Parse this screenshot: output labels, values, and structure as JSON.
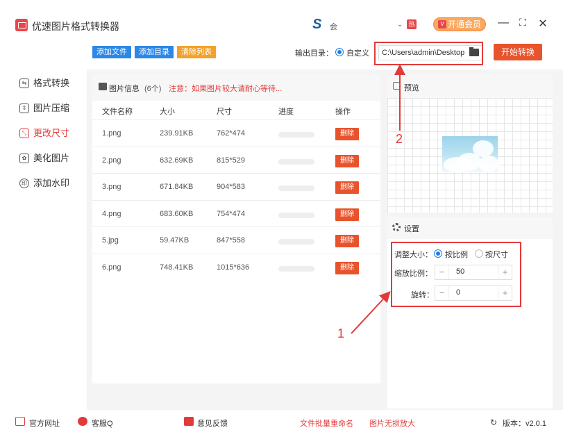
{
  "app": {
    "title": "优速图片格式转换器",
    "user_initial": "S",
    "user_name": "会",
    "hot_badge": "热",
    "vip_label": "开通会员",
    "vip_badge": "V"
  },
  "window": {
    "minimize": "—",
    "maximize": "⛶",
    "close": "✕",
    "dropdown": "⌄"
  },
  "toolbar": {
    "add_file": "添加文件",
    "add_dir": "添加目录",
    "clear_list": "清除列表",
    "output_label": "输出目录：",
    "output_option": "自定义",
    "output_path": "C:\\Users\\admin\\Desktop",
    "start": "开始转换",
    "colors": {
      "add": "#2c87e8",
      "clear": "#f2a12a",
      "start": "#e9532c"
    }
  },
  "sidebar": {
    "items": [
      {
        "label": "格式转换",
        "icon": "convert-icon",
        "glyph": "⇆",
        "active": false
      },
      {
        "label": "图片压缩",
        "icon": "compress-icon",
        "glyph": "⇕",
        "active": false
      },
      {
        "label": "更改尺寸",
        "icon": "resize-icon",
        "glyph": "⤡",
        "active": true
      },
      {
        "label": "美化图片",
        "icon": "beautify-icon",
        "glyph": "✿",
        "active": false
      },
      {
        "label": "添加水印",
        "icon": "watermark-icon",
        "glyph": "印",
        "active": false
      }
    ]
  },
  "file_list": {
    "title": "图片信息",
    "count": "(6个)",
    "warning": "注意：如果图片较大请耐心等待...",
    "columns": [
      "文件名称",
      "大小",
      "尺寸",
      "进度",
      "操作"
    ],
    "delete_label": "删除",
    "rows": [
      {
        "name": "1.png",
        "size": "239.91KB",
        "dims": "762*474"
      },
      {
        "name": "2.png",
        "size": "632.69KB",
        "dims": "815*529"
      },
      {
        "name": "3.png",
        "size": "671.84KB",
        "dims": "904*583"
      },
      {
        "name": "4.png",
        "size": "683.60KB",
        "dims": "754*474"
      },
      {
        "name": "5.jpg",
        "size": "59.47KB",
        "dims": "847*558"
      },
      {
        "name": "6.png",
        "size": "748.41KB",
        "dims": "1015*636"
      }
    ]
  },
  "preview": {
    "label": "预览"
  },
  "settings": {
    "label": "设置",
    "resize_label": "调整大小：",
    "option_ratio": "按比例",
    "option_size": "按尺寸",
    "scale_label": "缩放比例：",
    "scale_value": "50",
    "rotate_label": "旋转：",
    "rotate_value": "0",
    "minus": "−",
    "plus": "+"
  },
  "annotations": {
    "one": "1",
    "two": "2",
    "color": "#e23a3a"
  },
  "statusbar": {
    "website": "官方网址",
    "support": "客服Q",
    "feedback": "意见反馈",
    "batch_rename": "文件批量重命名",
    "lossless_zoom": "图片无损放大",
    "version": "版本：v2.0.1"
  }
}
